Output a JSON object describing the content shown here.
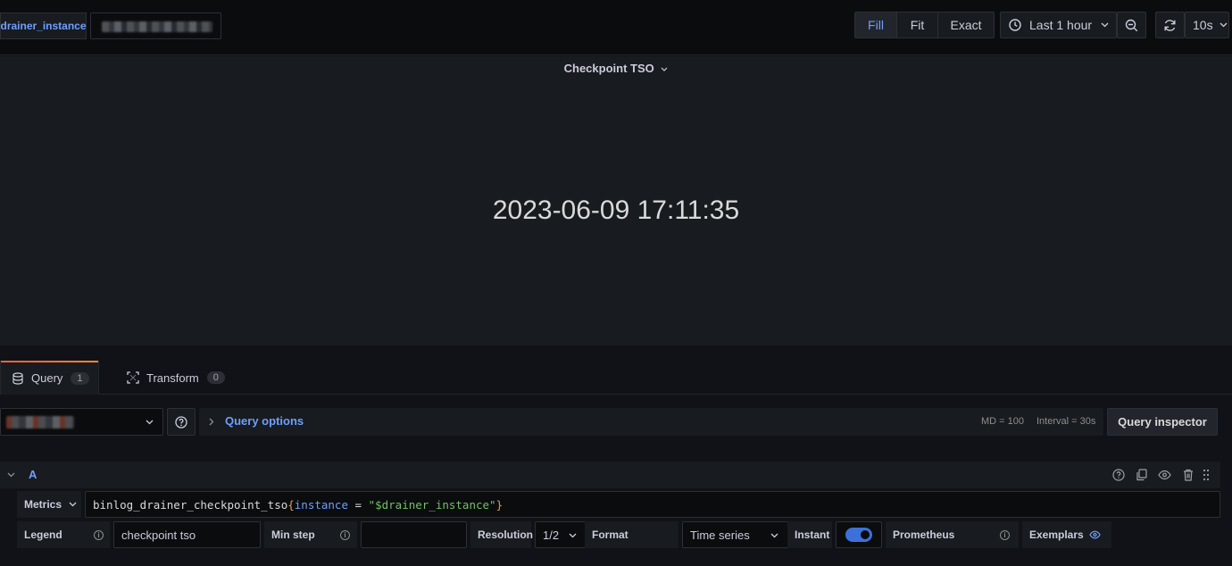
{
  "toolbar": {
    "variable_label": "drainer_instance",
    "view_modes": [
      "Fill",
      "Fit",
      "Exact"
    ],
    "active_view_mode": "Fill",
    "time_range": "Last 1 hour",
    "refresh_interval": "10s"
  },
  "panel": {
    "title": "Checkpoint TSO",
    "value": "2023-06-09 17:11:35"
  },
  "editor_tabs": [
    {
      "label": "Query",
      "count": "1",
      "active": true
    },
    {
      "label": "Transform",
      "count": "0",
      "active": false
    }
  ],
  "query_options": {
    "label": "Query options",
    "md": "MD = 100",
    "interval": "Interval = 30s",
    "inspector_label": "Query inspector"
  },
  "query_a": {
    "ref_id": "A",
    "metrics_label": "Metrics",
    "metric_name": "binlog_drainer_checkpoint_tso",
    "brace_open": "{",
    "label_key": "instance",
    "operator": " = ",
    "label_value": "\"$drainer_instance\"",
    "brace_close": "}",
    "legend_label": "Legend",
    "legend_value": "checkpoint tso",
    "min_step_label": "Min step",
    "min_step_value": "",
    "resolution_label": "Resolution",
    "resolution_value": "1/2",
    "format_label": "Format",
    "format_value": "Time series",
    "instant_label": "Instant",
    "instant_on": true,
    "prometheus_label": "Prometheus",
    "exemplars_label": "Exemplars"
  },
  "colors": {
    "accent": "#6e9fff",
    "tab_highlight": "#f55f3e",
    "background": "#111217",
    "panel": "#181b1f"
  }
}
